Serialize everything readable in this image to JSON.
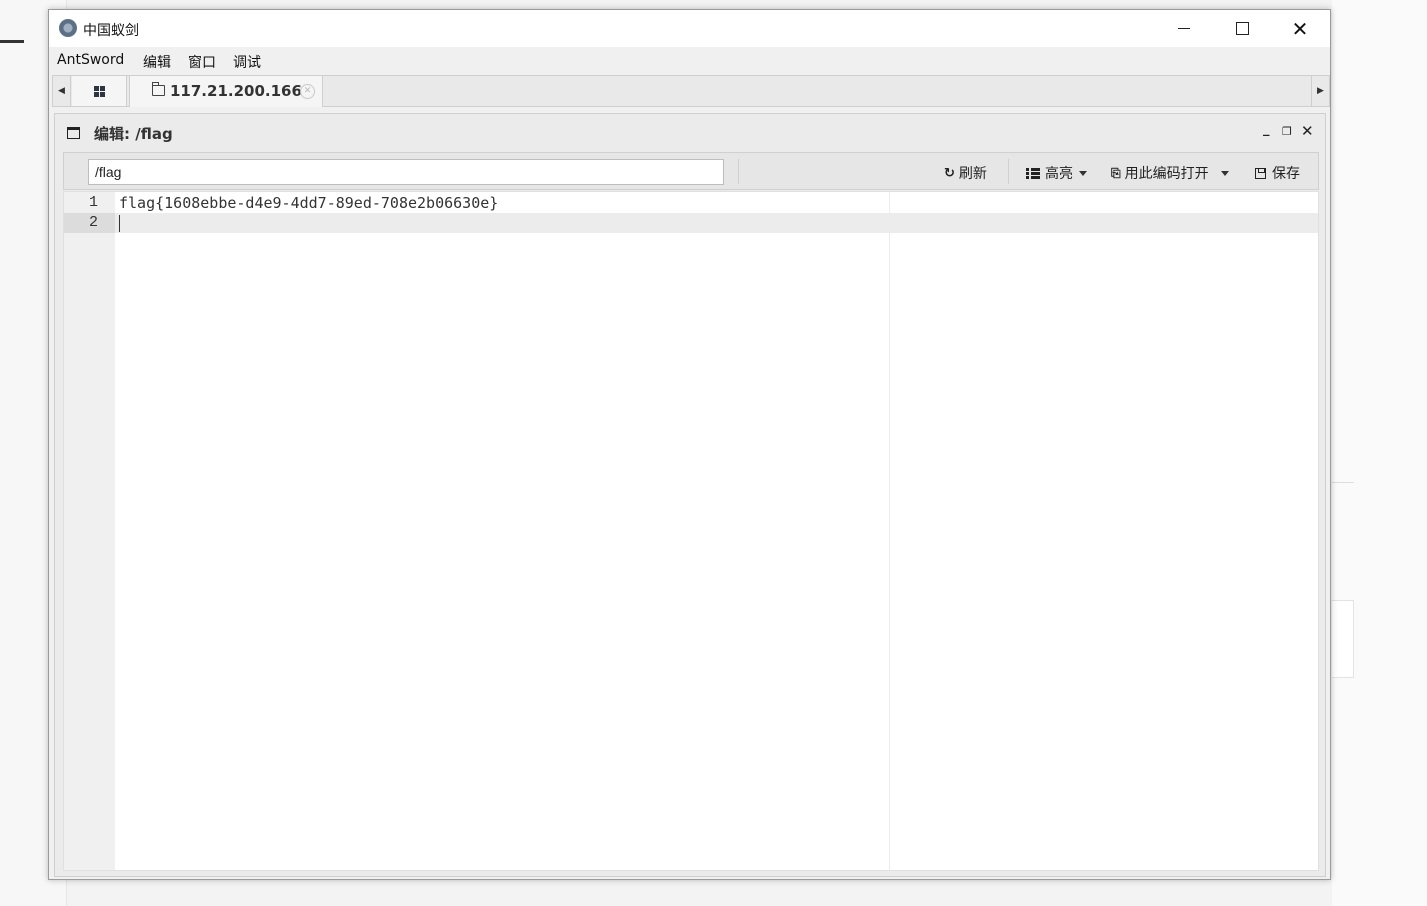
{
  "window": {
    "title": "中国蚁剑",
    "controls": {
      "minimize": "minimize-icon",
      "maximize": "maximize-icon",
      "close": "close-icon"
    }
  },
  "menu": [
    "AntSword",
    "编辑",
    "窗口",
    "调试"
  ],
  "tabs": {
    "home_icon": "grid-icon",
    "active": {
      "icon": "folder-icon",
      "label": "117.21.200.166",
      "close_icon": "close-circle-icon"
    }
  },
  "panel": {
    "title": "编辑: /flag",
    "path_value": "/flag",
    "toolbar": {
      "refresh": "刷新",
      "highlight": "高亮",
      "open_with_encoding": "用此编码打开",
      "save": "保存"
    }
  },
  "editor": {
    "lines": [
      {
        "number": "1",
        "text": "flag{1608ebbe-d4e9-4dd7-89ed-708e2b06630e}"
      },
      {
        "number": "2",
        "text": ""
      }
    ],
    "active_line": 2
  }
}
